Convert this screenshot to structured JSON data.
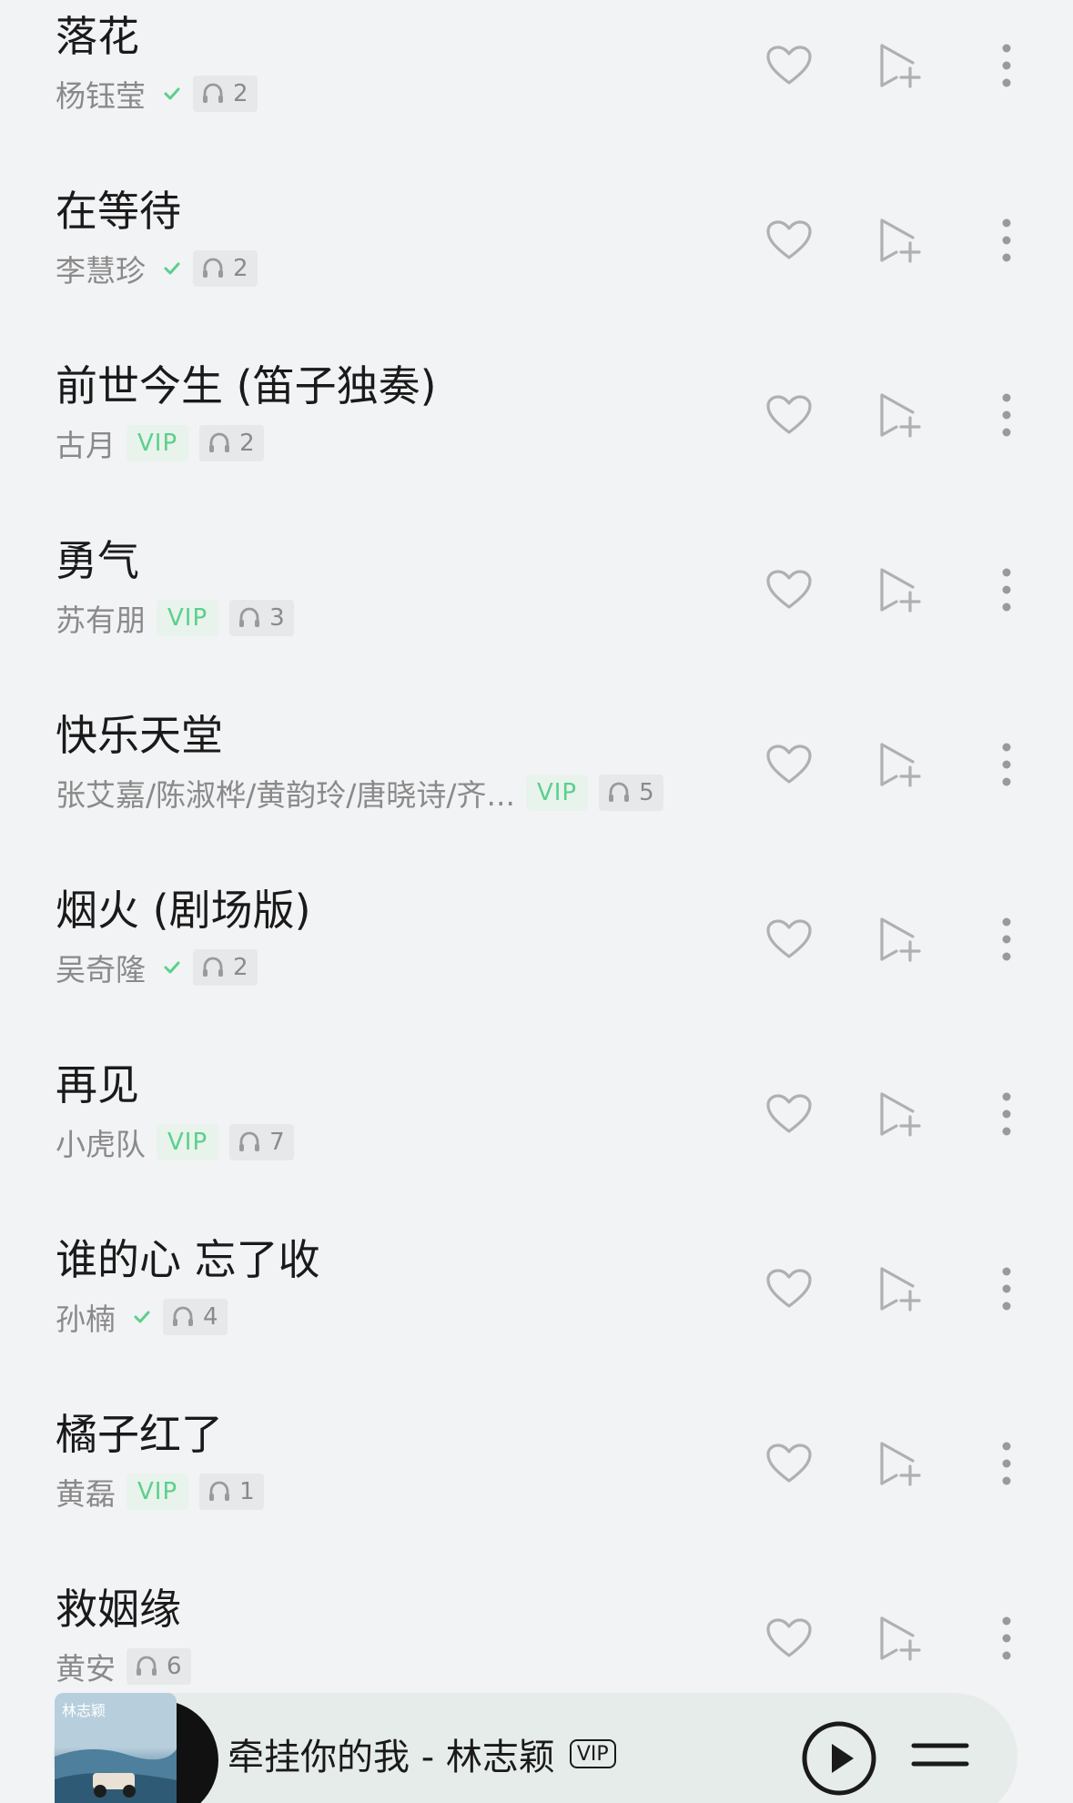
{
  "songs": [
    {
      "title": "落花",
      "artist": "杨钰莹",
      "badge": "verified",
      "vip_label": "",
      "listens": "2"
    },
    {
      "title": "在等待",
      "artist": "李慧珍",
      "badge": "verified",
      "vip_label": "",
      "listens": "2"
    },
    {
      "title": "前世今生 (笛子独奏)",
      "artist": "古月",
      "badge": "vip",
      "vip_label": "VIP",
      "listens": "2"
    },
    {
      "title": "勇气",
      "artist": "苏有朋",
      "badge": "vip",
      "vip_label": "VIP",
      "listens": "3"
    },
    {
      "title": "快乐天堂",
      "artist": "张艾嘉/陈淑桦/黄韵玲/唐晓诗/齐...",
      "badge": "vip",
      "vip_label": "VIP",
      "listens": "5"
    },
    {
      "title": "烟火 (剧场版)",
      "artist": "吴奇隆",
      "badge": "verified",
      "vip_label": "",
      "listens": "2"
    },
    {
      "title": "再见",
      "artist": "小虎队",
      "badge": "vip",
      "vip_label": "VIP",
      "listens": "7"
    },
    {
      "title": "谁的心 忘了收",
      "artist": "孙楠",
      "badge": "verified",
      "vip_label": "",
      "listens": "4"
    },
    {
      "title": "橘子红了",
      "artist": "黄磊",
      "badge": "vip",
      "vip_label": "VIP",
      "listens": "1"
    },
    {
      "title": "救姻缘",
      "artist": "黄安",
      "badge": "none",
      "vip_label": "",
      "listens": "6"
    }
  ],
  "icons": {
    "like": "heart-icon",
    "add": "add-to-playlist-icon",
    "more": "more-vertical-icon",
    "listen": "headphones-icon",
    "verified": "check-icon"
  },
  "colors": {
    "background": "#f2f3f5",
    "accent_green": "#5ccf8c",
    "vip_bg": "#e8f3ec",
    "text_primary": "#1a1a1a",
    "text_secondary": "#8a8a8a",
    "icon_gray": "#b0b0b0"
  },
  "mini_player": {
    "track_title": "牵挂你的我 - 林志颖",
    "vip_label": "VIP",
    "cover_text": "林志颖",
    "icons": {
      "play": "play-icon",
      "playlist": "playlist-icon"
    }
  }
}
